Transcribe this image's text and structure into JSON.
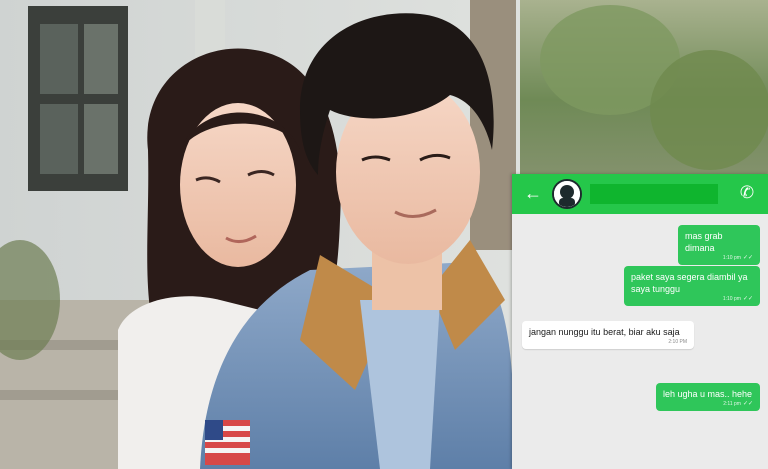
{
  "chat": {
    "header": {
      "back_icon": "arrow-left-icon",
      "call_icon": "phone-icon",
      "name_hidden": true
    },
    "messages": [
      {
        "direction": "out",
        "text": "mas grab dimana",
        "time": "1:10 pm"
      },
      {
        "direction": "out",
        "text": "paket saya segera diambil ya saya tunggu",
        "time": "1:10 pm"
      },
      {
        "direction": "in",
        "text": "jangan nunggu itu berat, biar aku saja",
        "time": "2:10 PM"
      },
      {
        "direction": "out",
        "text": "leh ugha u mas.. hehe",
        "time": "2:11 pm"
      }
    ],
    "colors": {
      "header": "#25c74a",
      "outgoing": "#2fc65a",
      "incoming": "#ffffff",
      "background": "#ebebeb"
    }
  },
  "photo": {
    "subjects": [
      "woman-long-dark-hair",
      "young-man-denim-jacket"
    ],
    "setting": "outdoor-garden-background"
  }
}
